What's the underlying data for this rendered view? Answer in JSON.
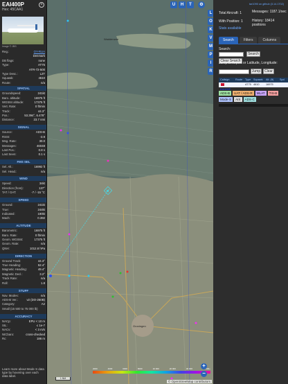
{
  "aircraft": {
    "callsign": "EAI400P",
    "hex_line": "Hex: 45CAA1",
    "close_icon": "close-icon",
    "photo_credit": "Image © JBS",
    "rows_top": [
      {
        "k": "Reg.:",
        "v": "OY-RUA",
        "link": true
      },
      {
        "k": "",
        "v": "Denmark",
        "link": false
      },
      {
        "k": "DB flags:",
        "v": "none",
        "link": false
      },
      {
        "k": "Type:",
        "v": "AT75",
        "link": false
      },
      {
        "k": "",
        "v": "ATR-72-500",
        "link": false
      },
      {
        "k": "Type Desc.:",
        "v": "L2T",
        "link": false
      },
      {
        "k": "Squawk:",
        "v": "4610",
        "link": false
      },
      {
        "k": "Route:",
        "v": "n/a",
        "link": false
      }
    ],
    "sections": [
      {
        "title": "SPATIAL",
        "rows": [
          {
            "k": "Groundspeed:",
            "v": "241kt"
          },
          {
            "k": "Baro. altitude:",
            "v": "16975 ft"
          },
          {
            "k": "WGS84 altitude:",
            "v": "17375 ft"
          },
          {
            "k": "Vert. Rate:",
            "v": "0 ft/min"
          },
          {
            "k": "Track:",
            "v": "44.3°"
          },
          {
            "k": "Pos.:",
            "v": "53.394°, 6.478°"
          },
          {
            "k": "Distance:",
            "v": "23.7 nmi"
          }
        ]
      },
      {
        "title": "SIGNAL",
        "rows": [
          {
            "k": "Source:",
            "v": "ADS-B"
          },
          {
            "k": "RSSI:",
            "v": "-3.9"
          },
          {
            "k": "Msg. Rate:",
            "v": "30.0"
          },
          {
            "k": "Messages:",
            "v": "46048"
          },
          {
            "k": "Last Pos.:",
            "v": "0.8 s"
          },
          {
            "k": "Last Seen:",
            "v": "0.1 s"
          }
        ]
      },
      {
        "title": "FMS SEL",
        "rows": [
          {
            "k": "Sel. Alt.:",
            "v": "16992 ft"
          },
          {
            "k": "Sel. Head.:",
            "v": "n/a"
          }
        ]
      },
      {
        "title": "WIND",
        "rows": [
          {
            "k": "Speed:",
            "v": "34kt"
          },
          {
            "k": "Direction (from):",
            "v": "137°"
          },
          {
            "k": "TAT / OAT:",
            "v": "-7 / -15 °C"
          }
        ]
      },
      {
        "title": "SPEED",
        "rows": [
          {
            "k": "Ground:",
            "v": "241kt"
          },
          {
            "k": "True:",
            "v": "244kt"
          },
          {
            "k": "Indicated:",
            "v": "190kt"
          },
          {
            "k": "Mach:",
            "v": "0.392"
          }
        ]
      },
      {
        "title": "ALTITUDE",
        "rows": [
          {
            "k": "Barometric:",
            "v": "16975 ft"
          },
          {
            "k": "Baro. Rate:",
            "v": "0 ft/min"
          },
          {
            "k": "Geom. WGS84:",
            "v": "17375 ft"
          },
          {
            "k": "Geom. Rate:",
            "v": "n/a"
          },
          {
            "k": "QNH:",
            "v": "1012.8 hPa"
          }
        ]
      },
      {
        "title": "DIRECTION",
        "rows": [
          {
            "k": "Ground Track:",
            "v": "44.3°"
          },
          {
            "k": "True Heading:",
            "v": "52.4°"
          },
          {
            "k": "Magnetic Heading:",
            "v": "49.4°"
          },
          {
            "k": "Magnetic Decl.:",
            "v": "3.2°"
          },
          {
            "k": "Track Rate:",
            "v": "n/a"
          },
          {
            "k": "Roll:",
            "v": "1.8"
          }
        ]
      },
      {
        "title": "STUFF",
        "rows": [
          {
            "k": "Nav. Modes:",
            "v": "n/a"
          },
          {
            "k": "ADS-B Ver.:",
            "v": "v2 (DO-260B)"
          },
          {
            "k": "Category:",
            "v": "A2"
          },
          {
            "k": "Small (15 500 to 75 000 lb)",
            "v": ""
          }
        ]
      },
      {
        "title": "ACCURACY",
        "rows": [
          {
            "k": "NACp:",
            "v": "EPU < 10 m"
          },
          {
            "k": "SIL:",
            "v": "≤ 1e-7"
          },
          {
            "k": "NACv:",
            "v": "< 3 m/s"
          },
          {
            "k": "NICbaro:",
            "v": "cross-checked"
          },
          {
            "k": "Rc:",
            "v": "186 m"
          }
        ]
      }
    ],
    "footnote": "Learn more about Mode S data type by hovering over each data label."
  },
  "map": {
    "top_buttons": [
      "U",
      "H",
      "T"
    ],
    "settings_icon": "gear-icon",
    "side_buttons": [
      "L",
      "O",
      "K",
      "V",
      "M",
      "P",
      "I",
      "R"
    ],
    "labels": {
      "wadden": "Waddenzee",
      "groningen": "Groningen"
    },
    "scale": "1 NM",
    "legend_ticks": [
      "2000",
      "4000",
      "6000",
      "8000",
      "10 000",
      "20 000",
      "30 000",
      "40 000+"
    ],
    "zoom_in": "+",
    "zoom_out": "−",
    "attribution": "© OpenStreetMap contributors"
  },
  "right": {
    "top_link": "tar1090 on github (3.14.1702)",
    "total_aircraft": "Total Aircraft: 1",
    "with_position": "With Position: 1",
    "messages": "Messages: 1187.1/sec",
    "history": "History: 18414 positions",
    "stats_link": "Stats available",
    "tabs": [
      "Search",
      "Filters",
      "Columns"
    ],
    "search_label": "Search:",
    "search_button": "Search",
    "clear_search_button": "Clear Search",
    "jump_label": "Jump to Airport or Latitude, Longitude:",
    "jump_button": "Jump",
    "clear_button": "Clear",
    "columns": [
      "Callsign",
      "Route",
      "Type",
      "Squawk",
      "Alt. (ft)",
      "Spd"
    ],
    "row": {
      "callsign": "EAI400P",
      "route": "",
      "type": "AT75",
      "squawk": "4610",
      "alt": "16975",
      "spd": ""
    },
    "chips": [
      {
        "label": "ADS-B",
        "color": "#9de0a0"
      },
      {
        "label": "UAT / ADS-R",
        "color": "#f0b070"
      },
      {
        "label": "MLAT",
        "color": "#c9a6ff"
      },
      {
        "label": "TIS-B",
        "color": "#f4a0a0"
      },
      {
        "label": "Mode-S",
        "color": "#b0c4ff"
      },
      {
        "label": "AIS",
        "color": "#e0e0e0"
      },
      {
        "label": "ADS-C",
        "color": "#a0e0e0"
      }
    ]
  }
}
